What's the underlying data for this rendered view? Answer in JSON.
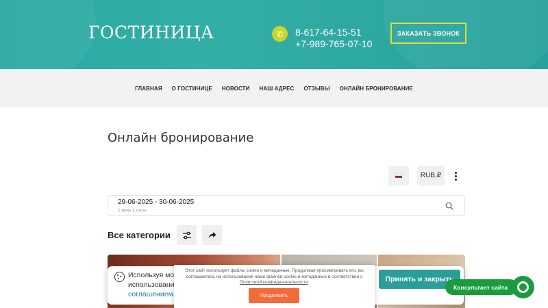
{
  "header": {
    "logo": "ГОСТИНИЦА",
    "phone_icon": "phone-icon",
    "phone1": "8-617-64-15-51",
    "phone2": "+7-989-765-07-10",
    "callback_label": "ЗАКАЗАТЬ ЗВОНОК",
    "background": "#2aa7a0",
    "accent": "#c8d62e"
  },
  "nav": {
    "items": [
      "ГЛАВНАЯ",
      "О ГОСТИНИЦЕ",
      "НОВОСТИ",
      "НАШ АДРЕС",
      "ОТЗЫВЫ",
      "ОНЛАЙН БРОНИРОВАНИЕ"
    ]
  },
  "main": {
    "title": "Онлайн бронирование",
    "language_flag": "russia-flag-icon",
    "currency": "RUB,₽",
    "date_range": "29-06-2025 - 30-06-2025",
    "guests": "1 ночь 1 гость",
    "categories_label": "Все категории"
  },
  "consent": {
    "line1": "Используя мод",
    "line2": "использование",
    "link": "соглашением.",
    "accept_label": "Принять и закрыть",
    "accept_color": "#2a9f98"
  },
  "popup": {
    "text": "Этот сайт использует файлы cookie и метаданные. Продолжая просматривать его, вы соглашаетесь на использование нами файлов cookie и метаданных в соответствии с ",
    "link": "Политикой конфиденциальности",
    "text_end": ".",
    "button": "Продолжить",
    "button_color": "#f26b3a"
  },
  "consultant": {
    "label": "Консультант сайта",
    "color": "#1a9c3c"
  }
}
